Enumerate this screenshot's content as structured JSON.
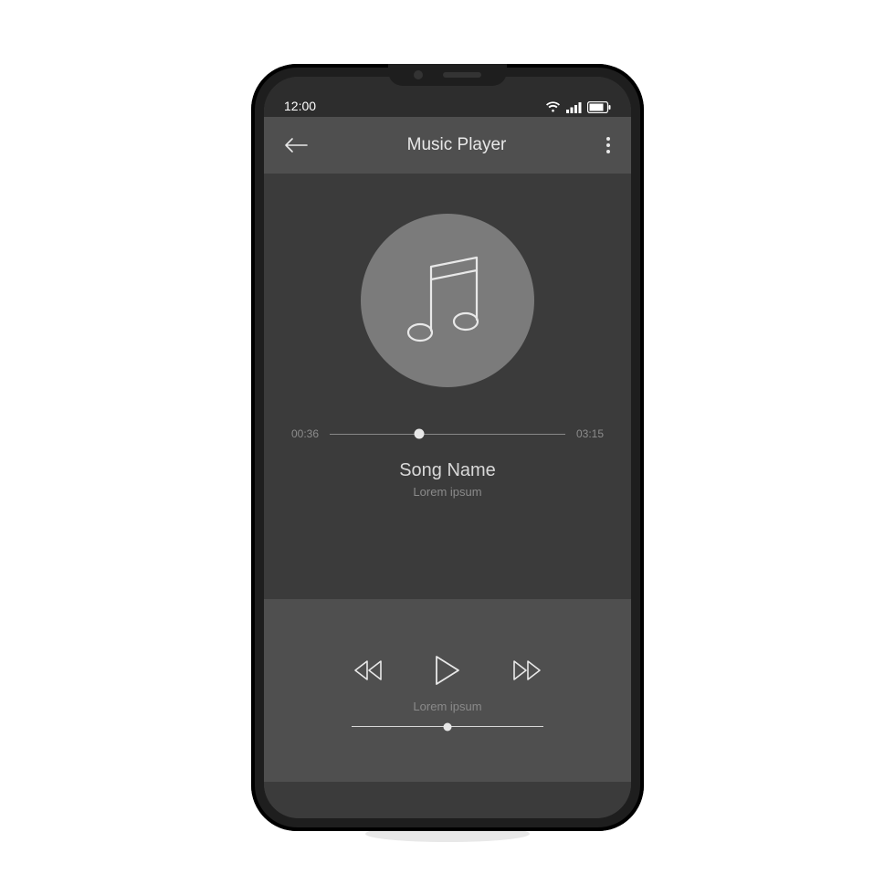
{
  "status": {
    "time": "12:00"
  },
  "header": {
    "title": "Music Player"
  },
  "player": {
    "elapsed": "00:36",
    "duration": "03:15",
    "song_title": "Song Name",
    "song_subtitle": "Lorem ipsum",
    "progress_percent": 38
  },
  "controls": {
    "volume_label": "Lorem ipsum",
    "volume_percent": 50
  },
  "colors": {
    "screen_bg": "#3b3b3b",
    "panel_bg": "#4f4f4f",
    "album_bg": "#7b7b7b",
    "text_primary": "#d8d8d8",
    "text_muted": "#8a8a8a"
  }
}
